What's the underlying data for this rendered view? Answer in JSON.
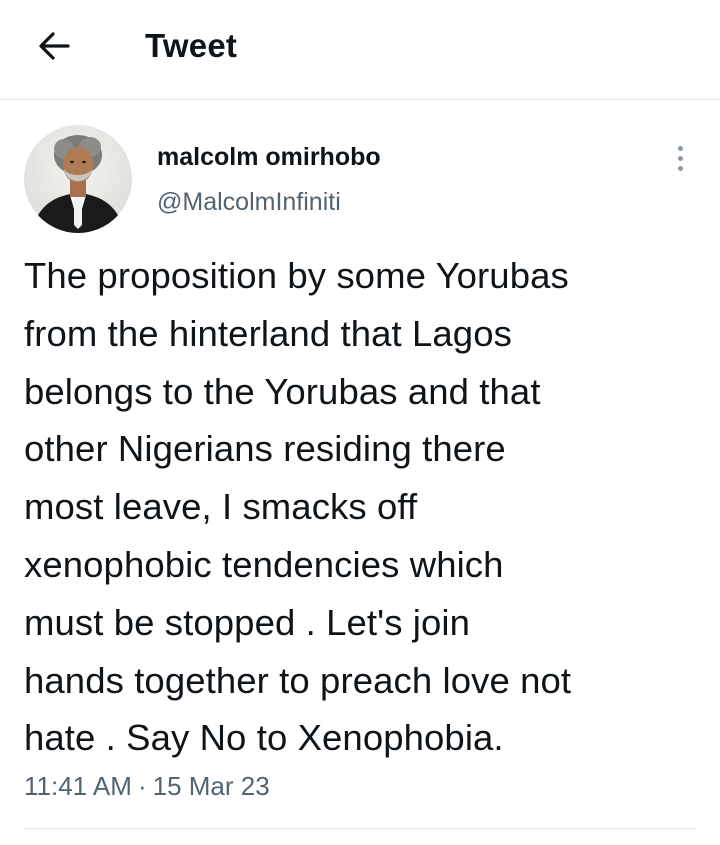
{
  "header": {
    "back_icon": "arrow-left-icon",
    "title": "Tweet"
  },
  "author": {
    "display_name": "malcolm omirhobo",
    "handle": "@MalcolmInfiniti",
    "avatar_icon": "avatar-photo"
  },
  "more_icon": "vertical-ellipsis-icon",
  "tweet": {
    "text": "The proposition by some Yorubas\nfrom the hinterland that Lagos\nbelongs to the Yorubas and that\nother Nigerians residing there\nmost leave, I smacks off\nxenophobic tendencies which\nmust be stopped . Let's join\nhands together to preach love not\nhate . Say No to Xenophobia.",
    "time": "11:41 AM",
    "separator": "·",
    "date": "15 Mar 23"
  },
  "colors": {
    "text_primary": "#0f1419",
    "text_secondary": "#536471",
    "divider": "#e1e5e8"
  }
}
